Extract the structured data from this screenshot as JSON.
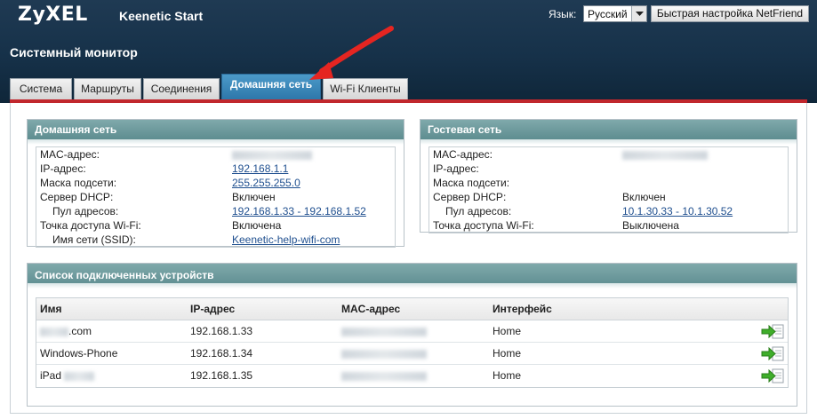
{
  "brand": {
    "logo": "ZyXEL",
    "product": "Keenetic Start"
  },
  "language": {
    "label": "Язык:",
    "selected": "Русский"
  },
  "quick_setup_label": "Быстрая настройка NetFriend",
  "page_title": "Системный монитор",
  "tabs": [
    {
      "label": "Система",
      "active": false
    },
    {
      "label": "Маршруты",
      "active": false
    },
    {
      "label": "Соединения",
      "active": false
    },
    {
      "label": "Домашняя сеть",
      "active": true
    },
    {
      "label": "Wi-Fi Клиенты",
      "active": false
    }
  ],
  "home_network": {
    "title": "Домашняя сеть",
    "rows": [
      {
        "key": "MAC-адрес:",
        "value": "",
        "redacted": true,
        "link": false
      },
      {
        "key": "IP-адрес:",
        "value": "192.168.1.1",
        "link": true
      },
      {
        "key": "Маска подсети:",
        "value": "255.255.255.0",
        "link": true
      },
      {
        "key": "Сервер DHCP:",
        "value": "Включен",
        "link": false
      },
      {
        "key": "Пул адресов:",
        "value": "192.168.1.33 - 192.168.1.52",
        "link": true,
        "indent": true
      },
      {
        "key": "Точка доступа Wi-Fi:",
        "value": "Включена",
        "link": false
      },
      {
        "key": "Имя сети (SSID):",
        "value": "Keenetic-help-wifi-com",
        "link": true,
        "indent": true
      }
    ]
  },
  "guest_network": {
    "title": "Гостевая сеть",
    "rows": [
      {
        "key": "MAC-адрес:",
        "value": "",
        "redacted": true,
        "link": false
      },
      {
        "key": "IP-адрес:",
        "value": "",
        "link": false
      },
      {
        "key": "Маска подсети:",
        "value": "",
        "link": false
      },
      {
        "key": "Сервер DHCP:",
        "value": "Включен",
        "link": false
      },
      {
        "key": "Пул адресов:",
        "value": "10.1.30.33 - 10.1.30.52",
        "link": true,
        "indent": true
      },
      {
        "key": "Точка доступа Wi-Fi:",
        "value": "Выключена",
        "link": false
      }
    ]
  },
  "devices": {
    "title": "Список подключенных устройств",
    "columns": [
      "Имя",
      "IP-адрес",
      "MAC-адрес",
      "Интерфейс"
    ],
    "rows": [
      {
        "name": ".com",
        "ip": "192.168.1.33",
        "mac": "",
        "interface": "Home"
      },
      {
        "name": "Windows-Phone",
        "ip": "192.168.1.34",
        "mac": "",
        "interface": "Home"
      },
      {
        "name": "iPad",
        "ip": "192.168.1.35",
        "mac": "",
        "interface": "Home"
      }
    ]
  },
  "icons": {
    "action": "green-arrow-add-icon",
    "annotation": "red-pointer-arrow"
  },
  "colors": {
    "header": "#163149",
    "accent_red": "#c1272d",
    "tab_active": "#2d77aa",
    "panel_head": "#6a9699",
    "link": "#1f4f8f"
  }
}
